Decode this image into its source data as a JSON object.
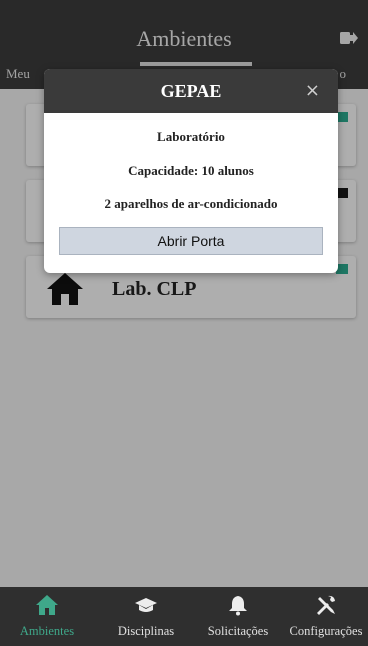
{
  "header": {
    "title": "Ambientes",
    "tab_left": "Meu",
    "tab_right": "o",
    "logout_icon": "logout-icon"
  },
  "cards": [
    {
      "badge_color": "#2aa58b"
    },
    {
      "badge_color": "#1a1a1a"
    },
    {
      "label": "Lab. CLP",
      "badge_color": "#2aa58b",
      "icon": "home-icon"
    }
  ],
  "modal": {
    "title": "GEPAE",
    "close_label": "×",
    "type": "Laboratório",
    "capacity": "Capacidade: 10 alunos",
    "ac": "2 aparelhos de ar-condicionado",
    "button_label": "Abrir Porta"
  },
  "nav": {
    "items": [
      {
        "label": "Ambientes",
        "icon": "home-icon",
        "active": true
      },
      {
        "label": "Disciplinas",
        "icon": "graduation-cap-icon",
        "active": false
      },
      {
        "label": "Solicitações",
        "icon": "bell-icon",
        "active": false
      },
      {
        "label": "Configurações",
        "icon": "tools-icon",
        "active": false
      }
    ],
    "active_color": "#3fa88a"
  }
}
